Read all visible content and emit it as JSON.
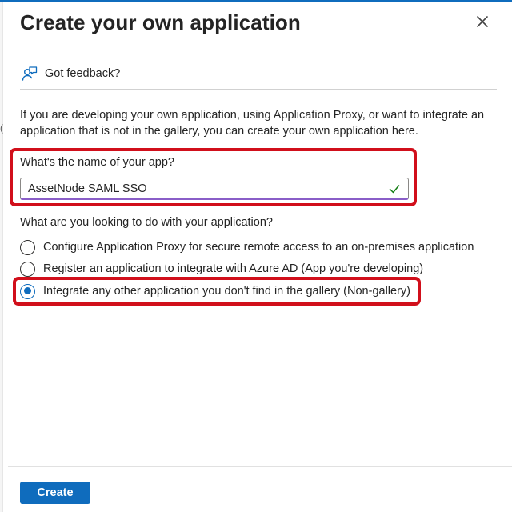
{
  "panel": {
    "title": "Create your own application",
    "close_icon": "close-icon"
  },
  "feedback": {
    "icon": "feedback-person-icon",
    "label": "Got feedback?"
  },
  "description": "If you are developing your own application, using Application Proxy, or want to integrate an application that is not in the gallery, you can create your own application here.",
  "app_name": {
    "label": "What's the name of your app?",
    "value": "AssetNode SAML SSO",
    "valid_icon": "checkmark-icon"
  },
  "purpose": {
    "question": "What are you looking to do with your application?",
    "options": [
      {
        "label": "Configure Application Proxy for secure remote access to an on-premises application",
        "selected": false
      },
      {
        "label": "Register an application to integrate with Azure AD (App you're developing)",
        "selected": false
      },
      {
        "label": "Integrate any other application you don't find in the gallery (Non-gallery)",
        "selected": true
      }
    ]
  },
  "footer": {
    "create_label": "Create"
  },
  "edge_glyph": "(",
  "colors": {
    "accent": "#0f6cbd",
    "highlight": "#d10f1b",
    "input_focus": "#8a5ec8",
    "valid_check": "#107c10"
  }
}
